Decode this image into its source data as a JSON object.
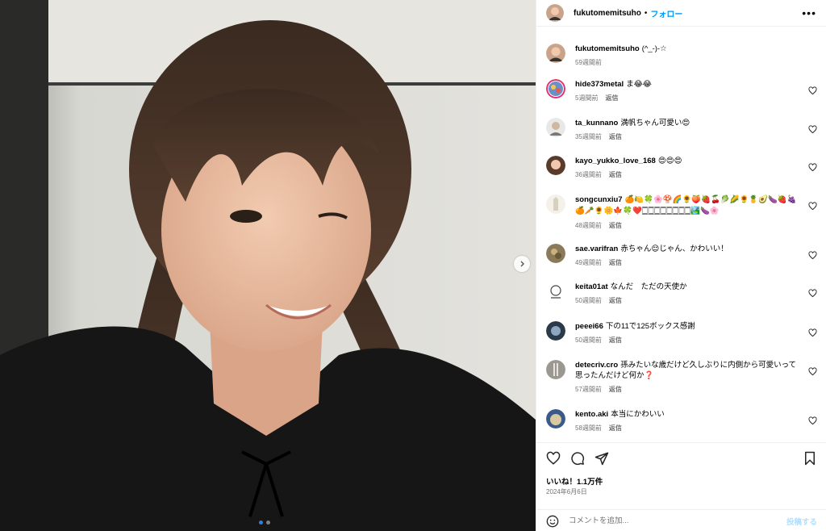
{
  "post": {
    "author": "fukutomemitsuho",
    "separator": "•",
    "follow_label": "フォロー",
    "more_label": "•••",
    "caption": {
      "user": "fukutomemitsuho",
      "text": "(^_-)-☆",
      "time": "59週間前"
    },
    "image_dots": 2,
    "active_dot": 0
  },
  "comments": [
    {
      "user": "hide373metal",
      "text": "ま😂😂",
      "time": "5週間前",
      "reply": "返信"
    },
    {
      "user": "ta_kunnano",
      "text": "満帆ちゃん可愛い😍",
      "time": "35週間前",
      "reply": "返信"
    },
    {
      "user": "kayo_yukko_love_168",
      "text": "😍😍😍",
      "time": "36週間前",
      "reply": "返信"
    },
    {
      "user": "songcunxiu7",
      "text": "🍊🍋🍀🌸🍄🌈🌻🍑🍓🍒🥬🌽🌻🍍🥑🍆🍓🍇🍊🥕🌻🌼🍁🍀❤️🀆🀆🀆🀆🀆🀆🀆🀆🏞️🍆🌸",
      "time": "48週間前",
      "reply": "返信"
    },
    {
      "user": "sae.varifran",
      "text": "赤ちゃん😌じゃん、かわいい！",
      "time": "49週間前",
      "reply": "返信"
    },
    {
      "user": "keita01at",
      "text": "なんだ　ただの天使か",
      "time": "50週間前",
      "reply": "返信"
    },
    {
      "user": "peeei66",
      "text": "下の11で125ボックス感謝",
      "time": "50週間前",
      "reply": "返信"
    },
    {
      "user": "detecriv.cro",
      "text": "孫みたいな歳だけど久しぶりに内側から可愛いって思ったんだけど何か❓",
      "time": "57週間前",
      "reply": "返信"
    },
    {
      "user": "kento.aki",
      "text": "本当にかわいい",
      "time": "58週間前",
      "reply": "返信"
    }
  ],
  "footer": {
    "likes": "いいね！1.1万件",
    "date": "2024年6月6日",
    "comment_placeholder": "コメントを追加...",
    "post_label": "投稿する"
  },
  "colors": {
    "link": "#0095f6",
    "muted": "#737373",
    "border": "#efefef",
    "post_disabled": "#b2dffc",
    "dot_active": "#2f7fe0"
  },
  "icons": [
    "more-icon",
    "next-arrow-icon",
    "heart-icon",
    "comment-icon",
    "share-icon",
    "bookmark-icon",
    "emoji-icon"
  ]
}
